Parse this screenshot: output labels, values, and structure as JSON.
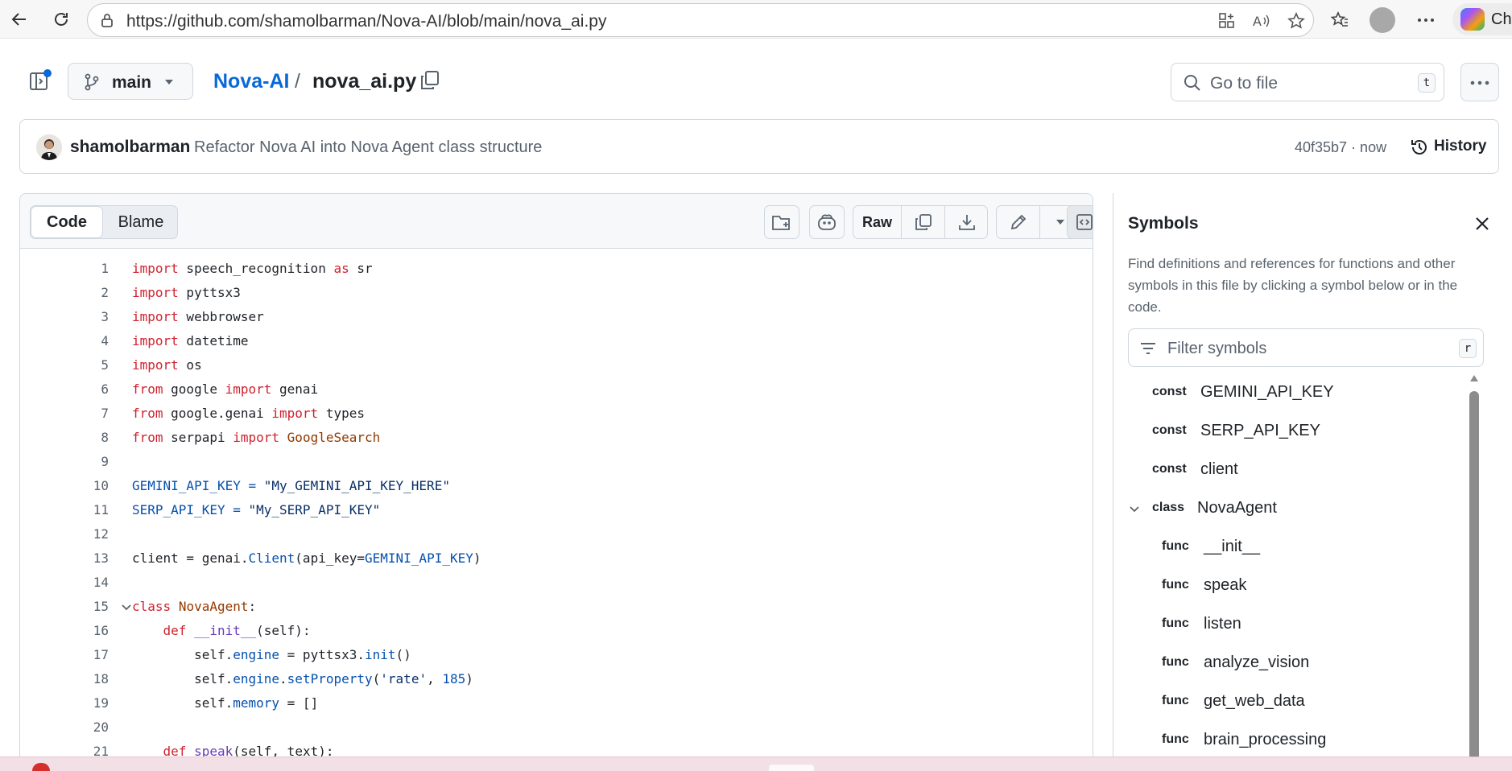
{
  "browser": {
    "url": "https://github.com/shamolbarman/Nova-AI/blob/main/nova_ai.py",
    "copilot_label": "Ch"
  },
  "header": {
    "branch": "main",
    "repo": "Nova-AI",
    "separator": "/",
    "file": "nova_ai.py",
    "goto_placeholder": "Go to file",
    "goto_shortcut": "t"
  },
  "commit": {
    "author": "shamolbarman",
    "message": "Refactor Nova AI into Nova Agent class structure",
    "sha_time": "40f35b7 · now",
    "history_label": "History"
  },
  "code_toolbar": {
    "tab_code": "Code",
    "tab_blame": "Blame",
    "raw_label": "Raw"
  },
  "code_lines": [
    {
      "n": "1"
    },
    {
      "n": "2"
    },
    {
      "n": "3"
    },
    {
      "n": "4"
    },
    {
      "n": "5"
    },
    {
      "n": "6"
    },
    {
      "n": "7"
    },
    {
      "n": "8"
    },
    {
      "n": "9"
    },
    {
      "n": "10"
    },
    {
      "n": "11"
    },
    {
      "n": "12"
    },
    {
      "n": "13"
    },
    {
      "n": "14"
    },
    {
      "n": "15"
    },
    {
      "n": "16"
    },
    {
      "n": "17"
    },
    {
      "n": "18"
    },
    {
      "n": "19"
    },
    {
      "n": "20"
    },
    {
      "n": "21"
    }
  ],
  "code_tokens": {
    "l1": [
      "import",
      " speech_recognition ",
      "as",
      " sr"
    ],
    "l2": [
      "import",
      " pyttsx3"
    ],
    "l3": [
      "import",
      " webbrowser"
    ],
    "l4": [
      "import",
      " datetime"
    ],
    "l5": [
      "import",
      " os"
    ],
    "l6": [
      "from",
      " google ",
      "import",
      " genai"
    ],
    "l7": [
      "from",
      " google.genai ",
      "import",
      " types"
    ],
    "l8": [
      "from",
      " serpapi ",
      "import",
      " ",
      "GoogleSearch"
    ],
    "l10": [
      "GEMINI_API_KEY",
      " = ",
      "\"My_GEMINI_API_KEY_HERE\""
    ],
    "l11": [
      "SERP_API_KEY",
      " = ",
      "\"My_SERP_API_KEY\""
    ],
    "l13": [
      "client = genai.",
      "Client",
      "(api_key=",
      "GEMINI_API_KEY",
      ")"
    ],
    "l15": [
      "class",
      " ",
      "NovaAgent",
      ":"
    ],
    "l16": [
      "    ",
      "def",
      " ",
      "__init__",
      "(self):"
    ],
    "l17": [
      "        self.",
      "engine",
      " = pyttsx3.",
      "init",
      "()"
    ],
    "l18": [
      "        self.",
      "engine",
      ".",
      "setProperty",
      "(",
      "'rate'",
      ", ",
      "185",
      ")"
    ],
    "l19": [
      "        self.",
      "memory",
      " = []"
    ],
    "l21": [
      "    ",
      "def",
      " ",
      "speak",
      "(self, text):"
    ]
  },
  "symbols": {
    "title": "Symbols",
    "description": "Find definitions and references for functions and other symbols in this file by clicking a symbol below or in the code.",
    "filter_placeholder": "Filter symbols",
    "filter_shortcut": "r",
    "items": [
      {
        "kind": "const",
        "name": "GEMINI_API_KEY"
      },
      {
        "kind": "const",
        "name": "SERP_API_KEY"
      },
      {
        "kind": "const",
        "name": "client"
      },
      {
        "kind": "class",
        "name": "NovaAgent"
      },
      {
        "kind": "func",
        "name": "__init__"
      },
      {
        "kind": "func",
        "name": "speak"
      },
      {
        "kind": "func",
        "name": "listen"
      },
      {
        "kind": "func",
        "name": "analyze_vision"
      },
      {
        "kind": "func",
        "name": "get_web_data"
      },
      {
        "kind": "func",
        "name": "brain_processing"
      }
    ]
  },
  "colors": {
    "link": "#0969da",
    "keyword": "#cf222e",
    "class": "#953800",
    "variable": "#0550ae",
    "string": "#0a3069"
  }
}
